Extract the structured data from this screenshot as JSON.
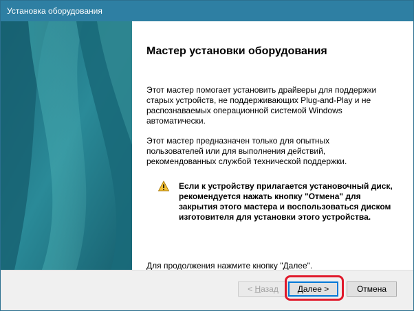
{
  "window": {
    "title": "Установка оборудования"
  },
  "colors": {
    "titlebar": "#2e7fa3",
    "side_panel": "#1e6f80",
    "accent_highlight": "#e0192b",
    "focus_border": "#0078d7"
  },
  "wizard": {
    "heading": "Мастер установки оборудования",
    "para1": "Этот мастер помогает установить драйверы для поддержки\nстарых устройств, не поддерживающих Plug-and-Play и не\nраспознаваемых операционной системой Windows\nавтоматически.",
    "para2": "Этот мастер предназначен только для опытных\nпользователей или для выполнения действий,\nрекомендованных службой технической поддержки.",
    "warning_icon": "warning-triangle-icon",
    "warning_text": "Если к устройству прилагается установочный диск,\nрекомендуется нажать кнопку \"Отмена\" для\nзакрытия этого мастера и воспользоваться диском\nизготовителя для установки этого устройства.",
    "continue_text": "Для продолжения нажмите кнопку \"Далее\"."
  },
  "buttons": {
    "back_prefix": "< ",
    "back_mnemonic": "Н",
    "back_rest": "азад",
    "next_mnemonic": "Д",
    "next_rest": "алее >",
    "cancel": "Отмена"
  }
}
